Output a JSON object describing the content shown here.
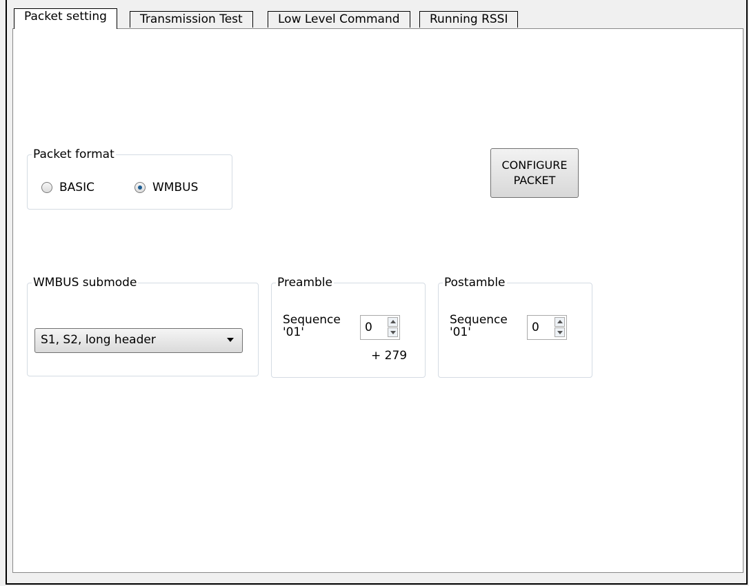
{
  "tabs": [
    {
      "label": "Packet setting"
    },
    {
      "label": "Transmission Test"
    },
    {
      "label": "Low Level Command"
    },
    {
      "label": "Running RSSI"
    }
  ],
  "packet_format": {
    "title": "Packet format",
    "options": [
      {
        "label": "BASIC",
        "checked": false
      },
      {
        "label": "WMBUS",
        "checked": true
      }
    ]
  },
  "configure_button": {
    "line1": "CONFIGURE",
    "line2": "PACKET"
  },
  "wmbus_submode": {
    "title": "WMBUS submode",
    "selected": "S1, S2, long header"
  },
  "preamble": {
    "title": "Preamble",
    "label_line1": "Sequence",
    "label_line2": "'01'",
    "value": "0",
    "suffix": "+ 279"
  },
  "postamble": {
    "title": "Postamble",
    "label_line1": "Sequence",
    "label_line2": "'01'",
    "value": "0"
  }
}
